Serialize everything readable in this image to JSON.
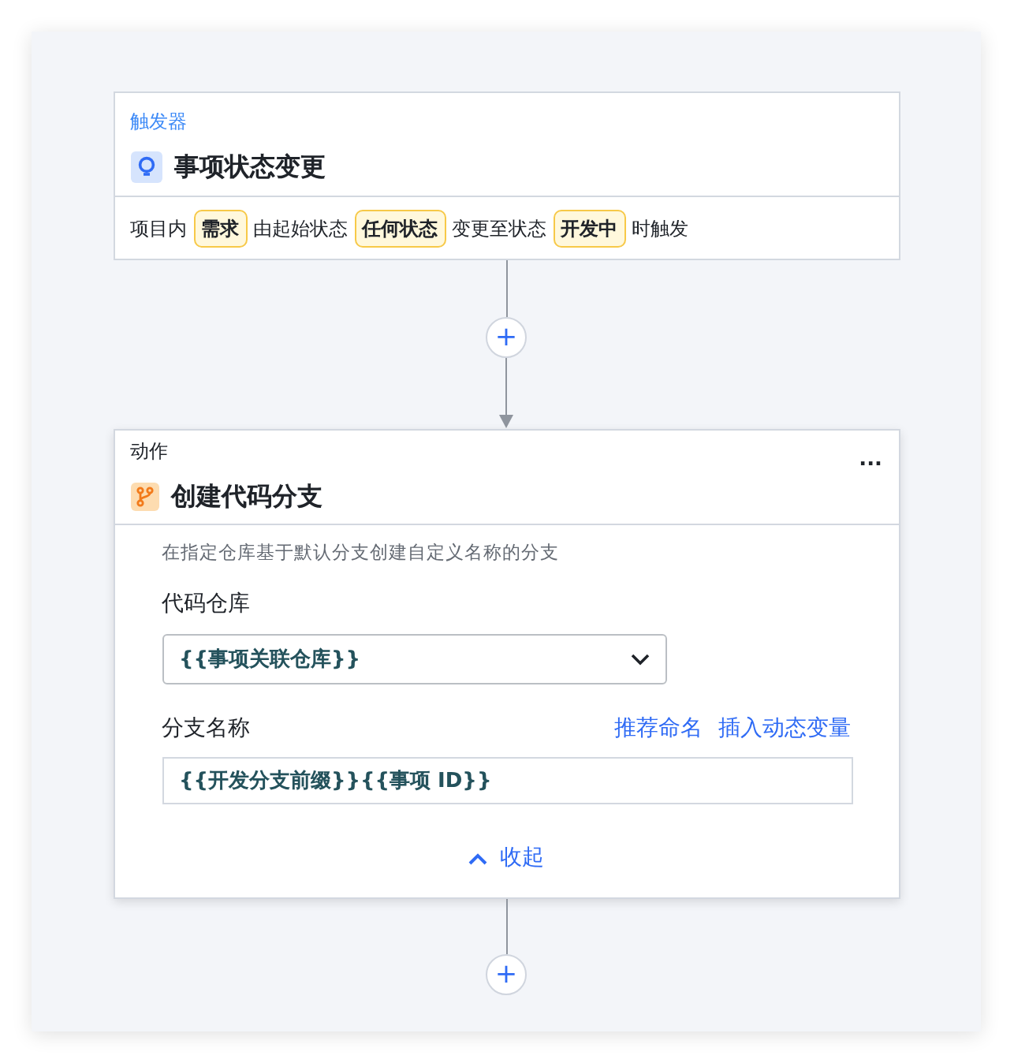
{
  "trigger": {
    "section_label": "触发器",
    "title": "事项状态变更",
    "condition": [
      {
        "kind": "text",
        "text": "项目内"
      },
      {
        "kind": "chip",
        "text": "需求"
      },
      {
        "kind": "text",
        "text": "由起始状态"
      },
      {
        "kind": "chip",
        "text": "任何状态"
      },
      {
        "kind": "text",
        "text": "变更至状态"
      },
      {
        "kind": "chip",
        "text": "开发中"
      },
      {
        "kind": "text",
        "text": "时触发"
      }
    ]
  },
  "action": {
    "section_label": "动作",
    "menu": "...",
    "title": "创建代码分支",
    "description": "在指定仓库基于默认分支创建自定义名称的分支",
    "repo_field": {
      "label": "代码仓库",
      "value": "{{事项关联仓库}}"
    },
    "branch_field": {
      "label": "分支名称",
      "links": [
        "推荐命名",
        "插入动态变量"
      ],
      "value": "{{开发分支前缀}}{{事项 ID}}"
    },
    "collapse": "收起"
  },
  "add_buttons": [
    "+",
    "+"
  ]
}
